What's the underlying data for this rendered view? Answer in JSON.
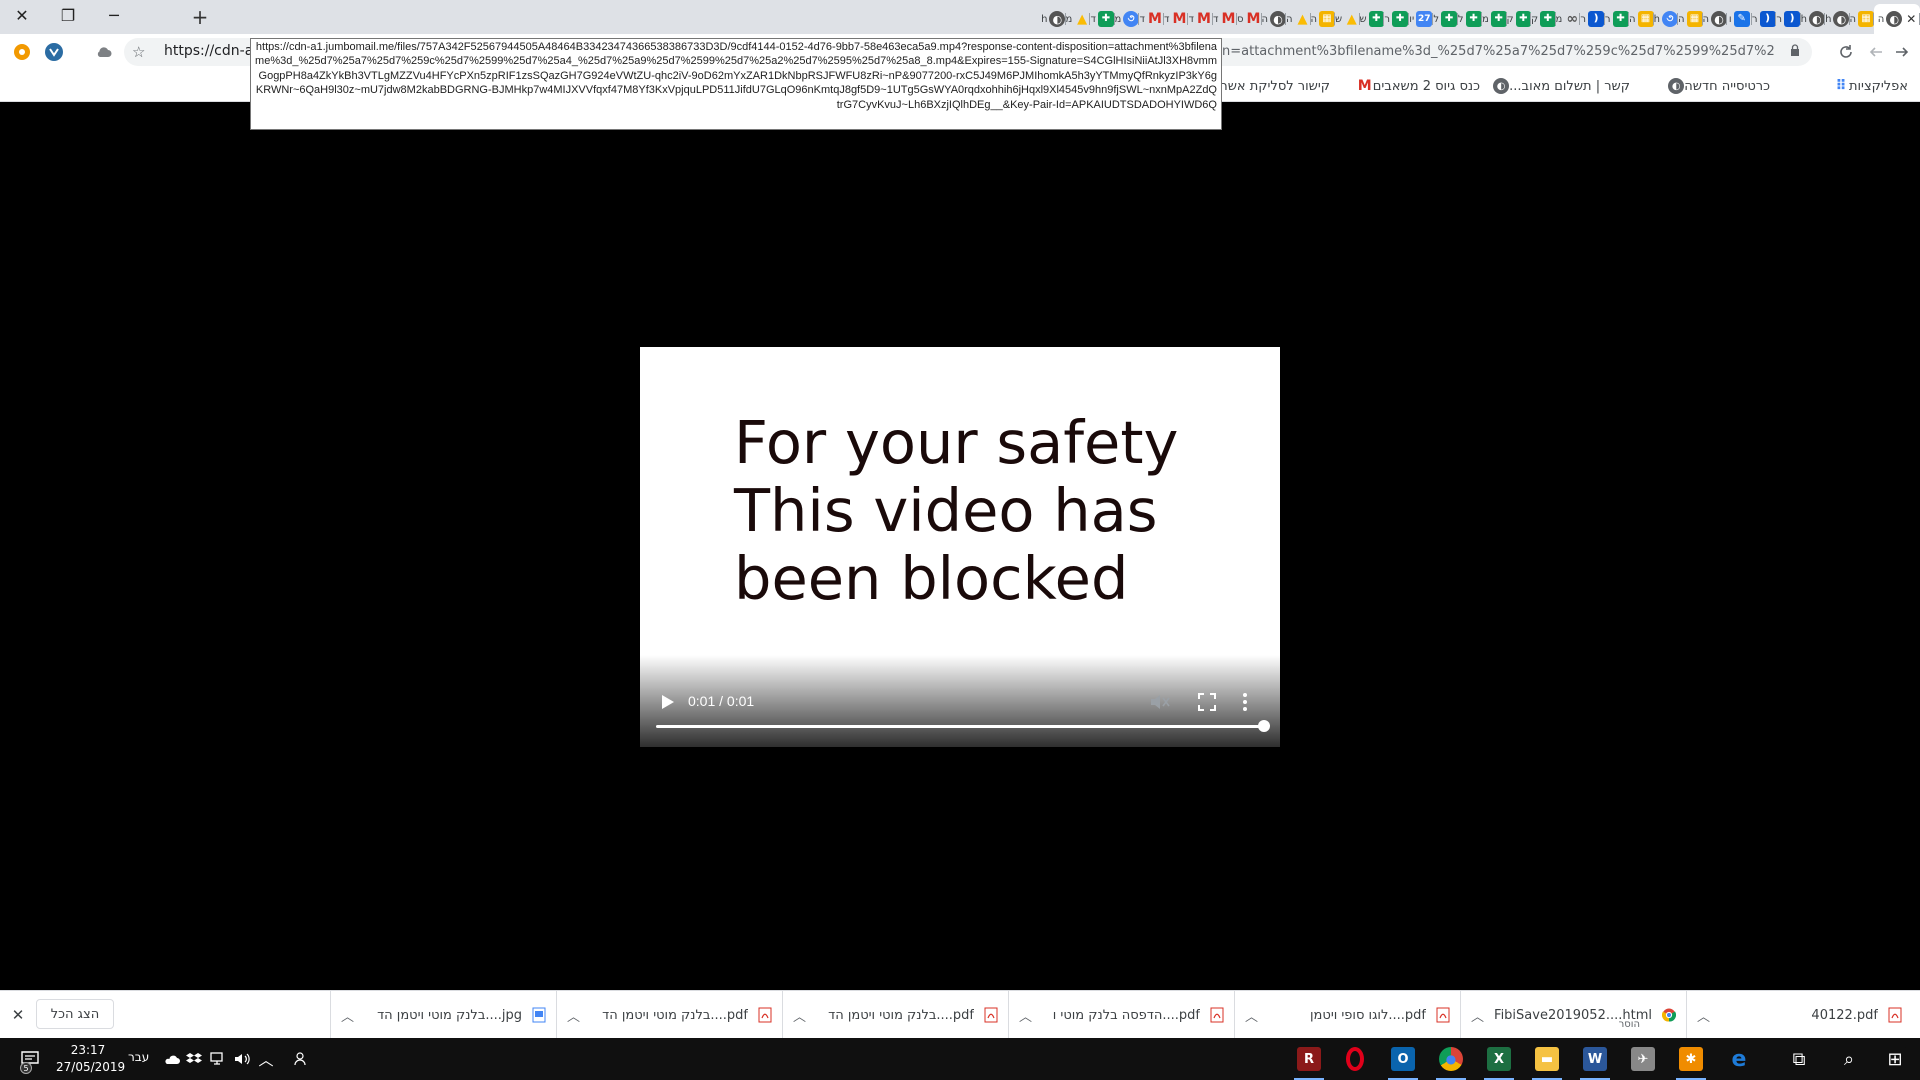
{
  "window": {
    "close_glyph": "✕",
    "restore_glyph": "❐",
    "minimize_glyph": "─",
    "new_tab_glyph": "+"
  },
  "tabs": [
    {
      "letter": "ה",
      "icon": "globe-icon",
      "color": "#555555",
      "active": true
    },
    {
      "letter": "ה",
      "icon": "bell-icon",
      "color": "#f4b400"
    },
    {
      "letter": "h",
      "icon": "globe-icon",
      "color": "#555555"
    },
    {
      "letter": "h",
      "icon": "globe-icon",
      "color": "#555555"
    },
    {
      "letter": "ר",
      "icon": "bracket-icon",
      "color": "#0b57d0"
    },
    {
      "letter": "ר",
      "icon": "bracket-icon",
      "color": "#0b57d0"
    },
    {
      "letter": "ו",
      "icon": "pencil-icon",
      "color": "#1a73e8"
    },
    {
      "letter": "ה",
      "icon": "globe-icon",
      "color": "#555555"
    },
    {
      "letter": "ה",
      "icon": "bell-icon",
      "color": "#f4b400"
    },
    {
      "letter": "h",
      "icon": "swirl-icon",
      "color": "#4285f4"
    },
    {
      "letter": "ה",
      "icon": "bell-icon",
      "color": "#f4b400"
    },
    {
      "letter": "ר",
      "icon": "plus-icon",
      "color": "#0f9d58"
    },
    {
      "letter": "ר",
      "icon": "bracket-icon",
      "color": "#0b57d0"
    },
    {
      "letter": "מ",
      "icon": "link-icon",
      "color": "#555555"
    },
    {
      "letter": "ק",
      "icon": "plus-icon",
      "color": "#0f9d58"
    },
    {
      "letter": "ק",
      "icon": "plus-icon",
      "color": "#0f9d58"
    },
    {
      "letter": "מ",
      "icon": "plus-icon",
      "color": "#0f9d58"
    },
    {
      "letter": "ל",
      "icon": "plus-icon",
      "color": "#0f9d58"
    },
    {
      "letter": "ל",
      "icon": "plus-icon",
      "color": "#0f9d58"
    },
    {
      "letter": "יו",
      "icon": "calendar-icon",
      "color": "#4285f4",
      "label": "27"
    },
    {
      "letter": "ר",
      "icon": "plus-icon",
      "color": "#0f9d58"
    },
    {
      "letter": "ש",
      "icon": "plus-icon",
      "color": "#0f9d58"
    },
    {
      "letter": "ש",
      "icon": "drive-icon",
      "color": "#fbbc04"
    },
    {
      "letter": "ה",
      "icon": "bell-icon",
      "color": "#f4b400"
    },
    {
      "letter": "ה",
      "icon": "drive-icon",
      "color": "#fbbc04"
    },
    {
      "letter": "ה",
      "icon": "globe-icon",
      "color": "#555555"
    },
    {
      "letter": "ס",
      "icon": "gmail-icon",
      "color": "#d93025"
    },
    {
      "letter": "ד",
      "icon": "gmail-icon",
      "color": "#d93025"
    },
    {
      "letter": "ד",
      "icon": "gmail-icon",
      "color": "#d93025"
    },
    {
      "letter": "ד",
      "icon": "gmail-icon",
      "color": "#d93025"
    },
    {
      "letter": "ד",
      "icon": "gmail-icon",
      "color": "#d93025"
    },
    {
      "letter": "מ",
      "icon": "swirl-icon",
      "color": "#4285f4"
    },
    {
      "letter": "ד",
      "icon": "plus-icon",
      "color": "#0f9d58"
    },
    {
      "letter": "מ",
      "icon": "drive-icon",
      "color": "#fbbc04"
    },
    {
      "letter": "h",
      "icon": "globe-icon",
      "color": "#555555"
    }
  ],
  "toolbar": {
    "url": "https://cdn-a1",
    "url_tail": "n=attachment%3bfilename%3d_%25d7%25a7%25d7%259c%25d7%2599%25d7%25a4_..."
  },
  "bookmarks": [
    {
      "label": "אפליקציות",
      "icon": "apps-icon",
      "color": "#4285f4"
    },
    {
      "label": "כרטיסייה חדשה",
      "icon": "globe-icon",
      "color": "#5f6368"
    },
    {
      "label": "קשר | תשלום מאוב...",
      "icon": "globe-icon",
      "color": "#5f6368"
    },
    {
      "label": "כנס גיוס 2 משאבים",
      "icon": "gmail-icon",
      "color": "#d93025"
    },
    {
      "label": "קישור לסליקת אשר...",
      "icon": "star-badge-icon",
      "color": "#c5221f"
    }
  ],
  "tooltip": {
    "text": "https://cdn-a1.jumbomail.me/files/757A342F52567944505A48464B33423474366538386733D3D/9cdf4144-0152-4d76-9bb7-58e463eca5a9.mp4?response-content-disposition=attachment%3bfilename%3d_%25d7%25a7%25d7%259c%25d7%2599%25d7%25a4_%25d7%25a9%25d7%2599%25d7%25a2%25d7%2595%25d7%25a8_8.mp4&Expires=155-Signature=S4CGlHIsiNiiAtJl3XH8vmmGogpPH8a4ZkYkBh3VTLgMZZVu4HFYcPXn5zpRIF1zsSQazGH7G924eVWtZU-qhc2iV-9oD62mYxZAR1DkNbpRSJFWFU8zRi~nP&9077200-rxC5J49M6PJMIhomkA5h3yYTMmyQfRnkyzIP3kY6gKRWNr~6QaH9l30z~mU7jdw8M2kabBDGRNG-BJMHkp7w4MIJXVVfqxf47M8Yf3KxVpjquLPD511JifdU7GLqO96nKmtqJ8gf5D9~1UTg5GsWYA0rqdxohhih6jHqxl9Xl4545v9hn9fjSWL~nxnMpA2ZdQtrG7CyvKvuJ~Lh6BXzjIQlhDEg__&Key-Pair-Id=APKAIUDTSDADOHYIWD6Q"
  },
  "video": {
    "message": "For your safety This video has been blocked",
    "current_time": "0:01",
    "duration": "0:01",
    "time_display": "0:01 / 0:01",
    "progress_fraction": 1.0
  },
  "downloads": {
    "show_all_label": "הצג הכל",
    "items": [
      {
        "name": "40122.pdf",
        "type": "pdf",
        "sub": ""
      },
      {
        "name": "FibiSave2019052....html",
        "type": "chrome",
        "sub": "הוסר"
      },
      {
        "name": "לוגו סופי ויטמן....pdf",
        "type": "pdf",
        "sub": ""
      },
      {
        "name": "הדפסה בלנק מוטי ו....pdf",
        "type": "pdf",
        "sub": ""
      },
      {
        "name": "בלנק מוטי ויטמן הד....pdf",
        "type": "pdf",
        "sub": ""
      },
      {
        "name": "בלנק מוטי ויטמן הד....pdf",
        "type": "pdf",
        "sub": ""
      },
      {
        "name": "בלנק מוטי ויטמן הד....jpg",
        "type": "jpg",
        "sub": ""
      }
    ]
  },
  "taskbar": {
    "time": "23:17",
    "date": "27/05/2019",
    "language": "עבר",
    "notification_count": "5",
    "apps": [
      {
        "name": "winrar-icon",
        "color": "#8b1a1a",
        "letter": "R",
        "running": true
      },
      {
        "name": "opera-icon",
        "color": "#e0001a",
        "letter": "O",
        "running": false
      },
      {
        "name": "outlook-icon",
        "color": "#0a64ad",
        "letter": "O",
        "running": true
      },
      {
        "name": "chrome-icon",
        "color": "#34a853",
        "letter": "●",
        "running": true
      },
      {
        "name": "excel-icon",
        "color": "#1d6f42",
        "letter": "X",
        "running": true
      },
      {
        "name": "file-explorer-icon",
        "color": "#f5c242",
        "letter": "▬",
        "running": true
      },
      {
        "name": "word-icon",
        "color": "#2b579a",
        "letter": "W",
        "running": true
      },
      {
        "name": "fighter-jet-icon",
        "color": "#888888",
        "letter": "✈",
        "running": false
      },
      {
        "name": "puzzle-app-icon",
        "color": "#f08c00",
        "letter": "✱",
        "running": true
      },
      {
        "name": "edge-icon",
        "color": "#1e7bd8",
        "letter": "e",
        "running": false
      },
      {
        "name": "task-view-icon",
        "color": "#101010",
        "letter": "⧉",
        "running": false
      },
      {
        "name": "search-icon",
        "color": "#101010",
        "letter": "⌕",
        "running": false
      },
      {
        "name": "start-icon",
        "color": "#101010",
        "letter": "⊞",
        "running": false
      }
    ]
  }
}
